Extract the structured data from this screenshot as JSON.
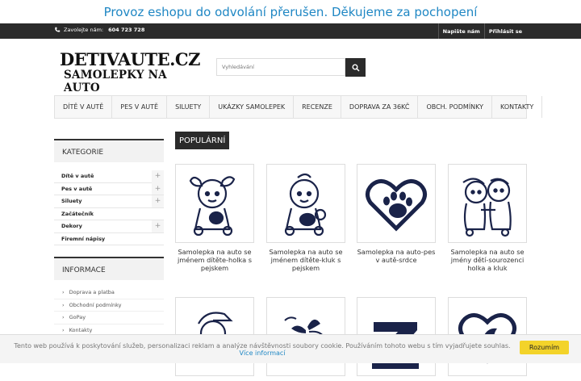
{
  "notice": "Provoz eshopu do odvolání přerušen. Děkujeme za pochopení",
  "topbar": {
    "phone_label": "Zavolejte nám:",
    "phone_number": "604 723 728",
    "links": [
      "Napište nám",
      "Přihlásit se"
    ]
  },
  "logo": {
    "line1": "DETIVAUTE.CZ",
    "line2": "SAMOLEPKY NA AUTO"
  },
  "search": {
    "placeholder": "Vyhledávání"
  },
  "nav": [
    "DÍTĚ V AUTĚ",
    "PES V AUTĚ",
    "SILUETY",
    "UKÁZKY SAMOLEPEK",
    "RECENZE",
    "DOPRAVA ZA 36KČ",
    "OBCH. PODMÍNKY",
    "KONTAKTY"
  ],
  "sidebar": {
    "categories_title": "KATEGORIE",
    "categories": [
      {
        "label": "Dítě v autě",
        "expandable": true
      },
      {
        "label": "Pes v autě",
        "expandable": true
      },
      {
        "label": "Siluety",
        "expandable": true
      },
      {
        "label": "Začátečník",
        "expandable": false
      },
      {
        "label": "Dekory",
        "expandable": true
      },
      {
        "label": "Firemní nápisy",
        "expandable": false
      }
    ],
    "info_title": "INFORMACE",
    "info": [
      "Doprava a platba",
      "Obchodní podmínky",
      "GoPay",
      "Kontakty"
    ]
  },
  "main": {
    "section_title": "POPULÁRNÍ",
    "products": [
      {
        "name": "Samolepka na auto se jménem dítěte-holka s pejskem",
        "icon": "girl-with-dog-icon"
      },
      {
        "name": "Samolepka na auto se jménem dítěte-kluk s pejskem",
        "icon": "boy-with-dog-icon"
      },
      {
        "name": "Samolepka na auto-pes v autě-srdce",
        "icon": "paw-heart-icon"
      },
      {
        "name": "Samolepka na auto se jmény dětí-sourozenci holka a kluk",
        "icon": "siblings-icon"
      },
      {
        "name": "",
        "icon": "boy-cap-icon"
      },
      {
        "name": "",
        "icon": "floral-decor-icon"
      },
      {
        "name": "",
        "icon": "letter-z-icon"
      },
      {
        "name": "",
        "icon": "heart-silhouette-icon"
      }
    ]
  },
  "cookie": {
    "text": "Tento web používá k poskytování služeb, personalizaci reklam a analýze návštěvnosti soubory cookie. Používáním tohoto webu s tím vyjadřujete souhlas.",
    "link": "Více informací",
    "button": "Rozumím"
  },
  "colors": {
    "accent": "#1f87c4",
    "dark": "#2b2b2b",
    "cookie_button": "#f3d32a"
  }
}
